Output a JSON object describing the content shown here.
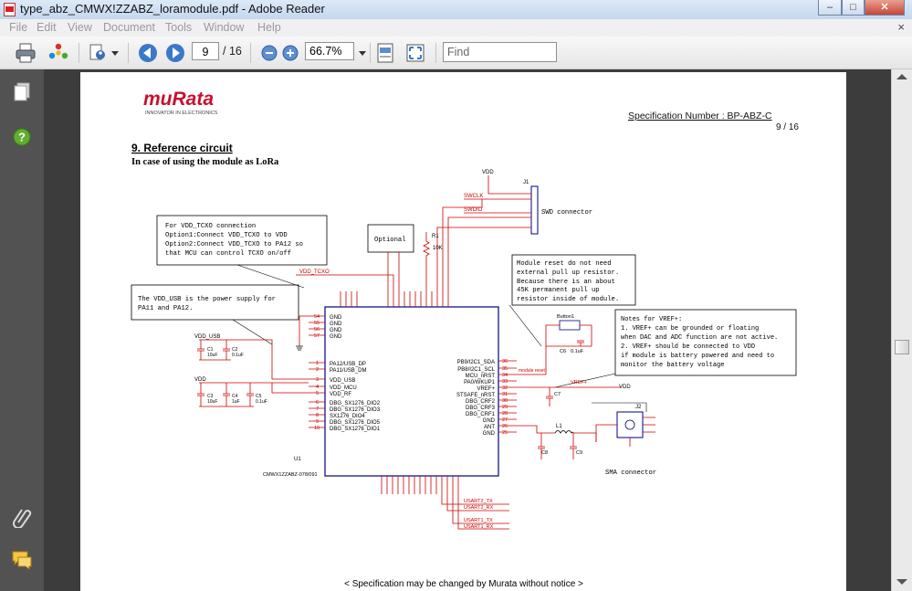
{
  "window": {
    "title": "type_abz_CMWX!ZZABZ_loramodule.pdf - Adobe Reader",
    "minimize": "–",
    "maximize": "□",
    "close": "✕"
  },
  "menu": {
    "items": [
      "File",
      "Edit",
      "View",
      "Document",
      "Tools",
      "Window",
      "Help"
    ],
    "close": "×"
  },
  "toolbar": {
    "page_number": "9",
    "page_total": "/ 16",
    "zoom": "66.7%",
    "find_placeholder": "Find"
  },
  "icons": {
    "left_rail": [
      "pages-icon",
      "help-icon",
      "attachment-icon",
      "comments-icon"
    ]
  },
  "document": {
    "logo": "muRata",
    "logo_tagline": "INNOVATOR IN ELECTRONICS",
    "spec_number": "Specification  Number  :  BP-ABZ-C",
    "page_indicator": "9 / 16",
    "section_title": "9. Reference circuit",
    "section_subtitle": "In case of using the module as LoRa",
    "footer": "< Specification may be changed by Murata without notice >",
    "notes": {
      "tcxo": [
        "For VDD_TCXO connection",
        "Option1:Connect VDD_TCXO to VDD",
        "Option2:Connect VDD_TCXO to PA12 so",
        "  that MCU can control TCXO on/off"
      ],
      "vdd_usb": [
        "The VDD_USB is the power supply for",
        "PA11 and PA12."
      ],
      "reset": [
        "Module reset do not need",
        "external pull up resistor.",
        "Because there is an about",
        "45K permanent pull up",
        "resistor inside of module."
      ],
      "vref": [
        "Notes for VREF+:",
        "1. VREF+ can be grounded or floating",
        "   when DAC and ADC function are not active.",
        "2. VREF+ should be connected to VDD",
        "   if module is battery powered and need to",
        "   monitor the battery voltage"
      ],
      "optional": "Optional"
    },
    "labels": {
      "swd_connector": "SWD connector",
      "sma_connector": "SMA connector",
      "j1": "J1",
      "j2": "J2",
      "vdd": "VDD",
      "vdd_tcxo": "VDD_TCXO",
      "vdd_usb": "VDD_USB",
      "swclk": "SWCLK",
      "swdio": "SWDIO",
      "r1": "R1",
      "r1_value": "10K",
      "button1": "Button1",
      "c6": "C6",
      "c6_value": "0.1uF",
      "c7": "C7",
      "module_reset": "module reset",
      "vref_plus": "VREF+",
      "u1": "U1",
      "module_part": "CMWX1ZZABZ-078/091",
      "l1": "L1",
      "c8": "C8",
      "c9": "C9",
      "c1": "C1",
      "c1_value": "10uF",
      "c2": "C2",
      "c2_value": "0.1uF",
      "c3": "C3",
      "c3_value": "10uF",
      "c4": "C4",
      "c4_value": "1uF",
      "c5": "C5",
      "c5_value": "0.1uF",
      "usart2_tx": "USART2_TX",
      "usart2_rx": "USART2_RX",
      "usart1_tx": "USART1_TX",
      "usart1_rx": "USART1_RX"
    },
    "left_pins": [
      "PA12/USB_DP",
      "PA11/USB_DM",
      "VDD_USB",
      "VDD_MCU",
      "VDD_RF",
      "DBG_SX1276_DIO2",
      "DBG_SX1276_DIO3",
      "SX1276_DIO4",
      "DBG_SX1276_DIO5",
      "DBG_SX1276_DIO1"
    ],
    "left_pin_numbers": [
      "1",
      "2",
      "3",
      "4",
      "5",
      "6",
      "7",
      "8",
      "9",
      "10"
    ],
    "gnd_pins": [
      "GND",
      "GND",
      "GND",
      "GND"
    ],
    "gnd_pin_numbers": [
      "54",
      "55",
      "56",
      "57"
    ],
    "right_pins": [
      "PB9/I2C1_SDA",
      "PB8/I2C1_SCL",
      "MCU_nRST",
      "PA0/WKUP1",
      "VREF+",
      "STSAFE_nRST",
      "DBG_CRF2",
      "DBG_CRF3",
      "DBG_CRF1",
      "GND",
      "ANT",
      "GND"
    ],
    "right_pin_numbers": [
      "36",
      "35",
      "34",
      "33",
      "32",
      "31",
      "30",
      "29",
      "28",
      "27",
      "26",
      "25"
    ]
  }
}
